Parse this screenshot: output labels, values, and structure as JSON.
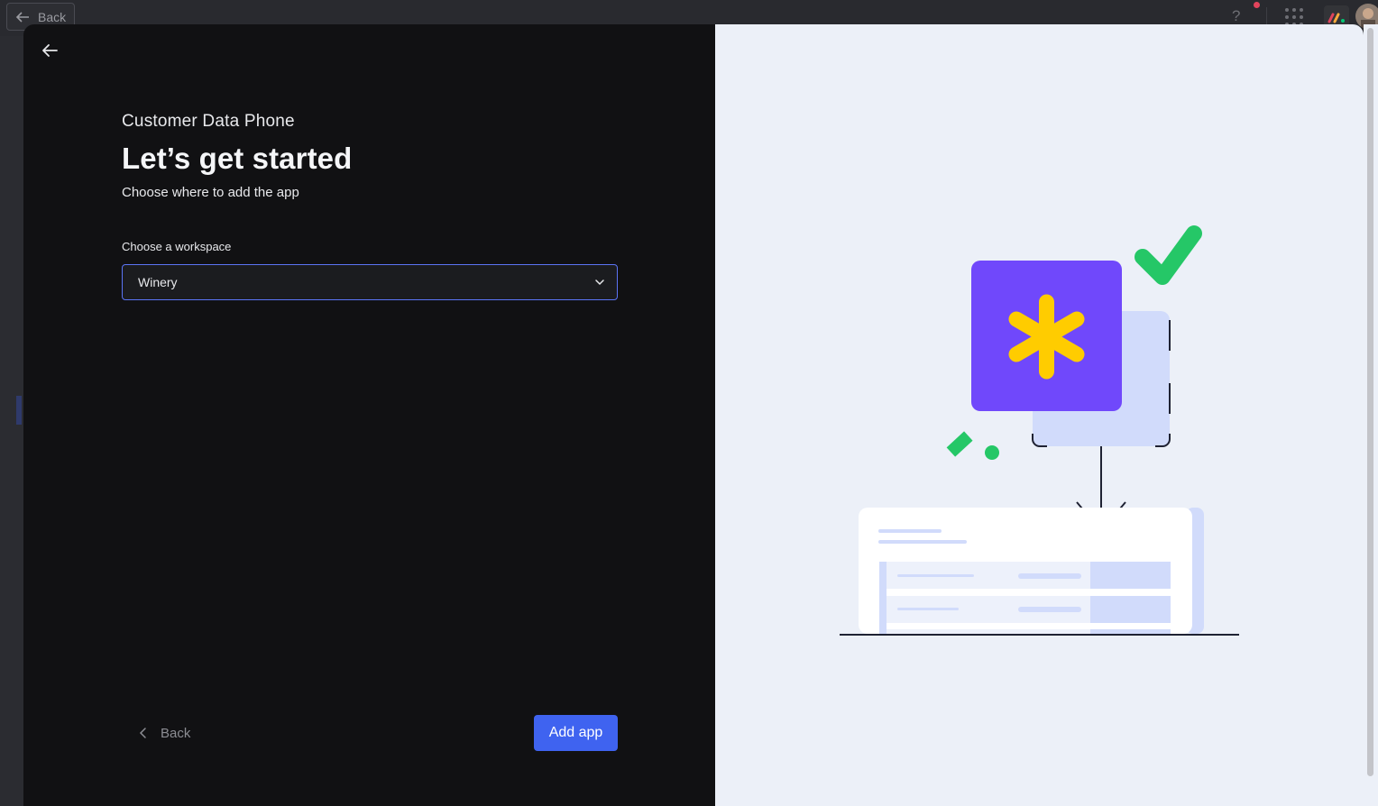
{
  "background": {
    "back_label": "Back",
    "help_label": "?"
  },
  "modal": {
    "app_name": "Customer Data Phone",
    "heading": "Let’s get started",
    "subheading": "Choose where to add the app",
    "workspace_label": "Choose a workspace",
    "workspace_selected": "Winery",
    "back_label": "Back",
    "add_label": "Add app"
  },
  "colors": {
    "primary": "#3f63f0",
    "left_pane": "#111113",
    "right_pane": "#ecf0f8",
    "purple": "#7048fb",
    "yellow": "#ffcc00",
    "green": "#25c767",
    "light_blue": "#d1dbfb"
  },
  "icons": {
    "modal_back": "arrow-left-icon",
    "select_chevron": "chevron-down-icon",
    "footer_back": "chevron-left-icon"
  }
}
